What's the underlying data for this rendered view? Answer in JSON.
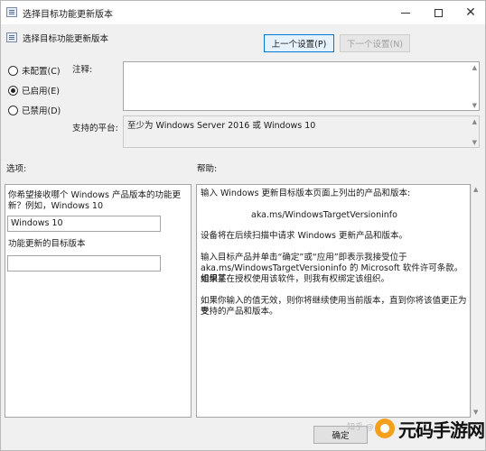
{
  "window": {
    "title": "选择目标功能更新版本",
    "min_icon": "minimize-icon",
    "max_icon": "maximize-icon",
    "close_glyph": "✕"
  },
  "header": {
    "setting_name": "选择目标功能更新版本",
    "prev_button": "上一个设置(P)",
    "next_button": "下一个设置(N)"
  },
  "state": {
    "options": [
      {
        "label": "未配置(C)",
        "checked": false
      },
      {
        "label": "已启用(E)",
        "checked": true
      },
      {
        "label": "已禁用(D)",
        "checked": false
      }
    ],
    "comment_label": "注释:",
    "platform_label": "支持的平台:",
    "platform_value": "至少为 Windows Server 2016 或 Windows 10"
  },
  "options_panel": {
    "title": "选项:",
    "question_line1": "你希望接收哪个 Windows 产品版本的功能更",
    "question_line2": "新？例如，Windows 10",
    "product_value": "Windows 10",
    "target_label": "功能更新的目标版本",
    "target_value": ""
  },
  "help_panel": {
    "title": "帮助:",
    "line1": "输入 Windows 更新目标版本页面上列出的产品和版本:",
    "line2": "aka.ms/WindowsTargetVersioninfo",
    "line3": "设备将在后续扫描中请求 Windows 更新产品和版本。",
    "line4a": "输入目标产品并单击“确定”或“应用”即表示我接受位于",
    "line4b": "aka.ms/WindowsTargetVersioninfo 的 Microsoft 软件许可条款。如果某",
    "line4c": "组织正在授权使用该软件，则我有权绑定该组织。",
    "line5a": "如果你输入的值无效，则你将继续使用当前版本，直到你将该值更正为受",
    "line5b": "支持的产品和版本。"
  },
  "footer": {
    "ok_button": "确定",
    "watermark": "知乎 @...",
    "brand": "元码手游网"
  }
}
